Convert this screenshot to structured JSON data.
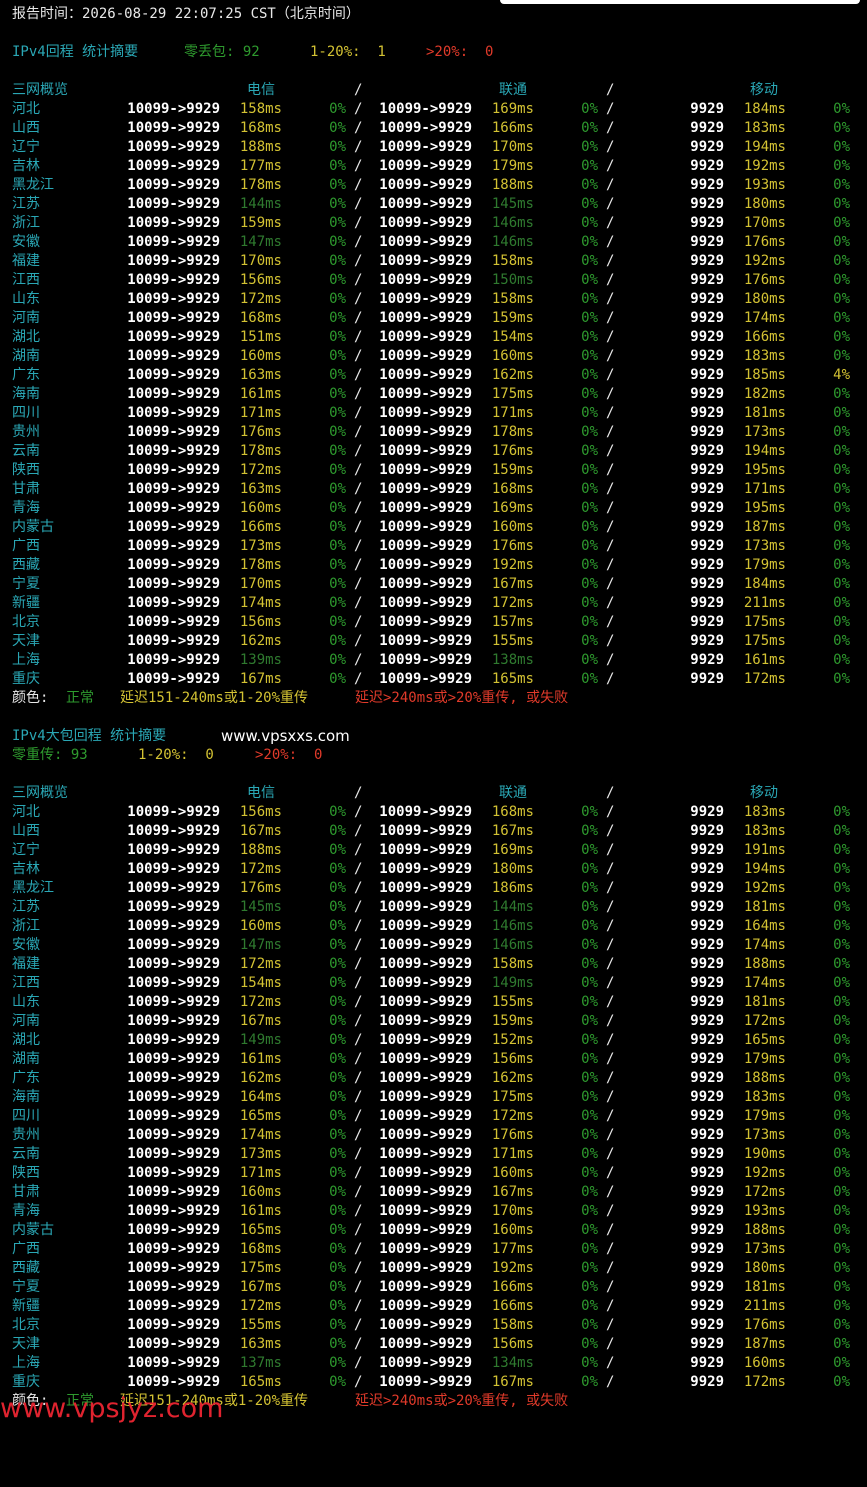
{
  "header": {
    "report_time": "报告时间：2026-08-29 22:07:25 CST（北京时间）"
  },
  "section1": {
    "title": "IPv4回程 统计摘要",
    "zero_label": "零丢包: 92",
    "mid_label": "1-20%:  1",
    "high_label": ">20%:  0",
    "head": {
      "overview": "三网概览",
      "ct": "电信",
      "cu": "联通",
      "cm": "移动",
      "slash": "/"
    },
    "rows": [
      {
        "p": "河北",
        "ct": "158ms",
        "cu": "169ms",
        "cm": "184ms",
        "cml": "0%",
        "ctc": "yl",
        "cuc": "yl",
        "cmc": "yl",
        "cmlc": "gn"
      },
      {
        "p": "山西",
        "ct": "168ms",
        "cu": "166ms",
        "cm": "183ms",
        "cml": "0%",
        "ctc": "yl",
        "cuc": "yl",
        "cmc": "yl",
        "cmlc": "gn"
      },
      {
        "p": "辽宁",
        "ct": "188ms",
        "cu": "170ms",
        "cm": "194ms",
        "cml": "0%",
        "ctc": "yl",
        "cuc": "yl",
        "cmc": "yl",
        "cmlc": "gn"
      },
      {
        "p": "吉林",
        "ct": "177ms",
        "cu": "179ms",
        "cm": "192ms",
        "cml": "0%",
        "ctc": "yl",
        "cuc": "yl",
        "cmc": "yl",
        "cmlc": "gn"
      },
      {
        "p": "黑龙江",
        "ct": "178ms",
        "cu": "188ms",
        "cm": "193ms",
        "cml": "0%",
        "ctc": "yl",
        "cuc": "yl",
        "cmc": "yl",
        "cmlc": "gn"
      },
      {
        "p": "江苏",
        "ct": "144ms",
        "cu": "145ms",
        "cm": "180ms",
        "cml": "0%",
        "ctc": "dg",
        "cuc": "dg",
        "cmc": "yl",
        "cmlc": "gn"
      },
      {
        "p": "浙江",
        "ct": "159ms",
        "cu": "146ms",
        "cm": "170ms",
        "cml": "0%",
        "ctc": "yl",
        "cuc": "dg",
        "cmc": "yl",
        "cmlc": "gn"
      },
      {
        "p": "安徽",
        "ct": "147ms",
        "cu": "146ms",
        "cm": "176ms",
        "cml": "0%",
        "ctc": "dg",
        "cuc": "dg",
        "cmc": "yl",
        "cmlc": "gn"
      },
      {
        "p": "福建",
        "ct": "170ms",
        "cu": "158ms",
        "cm": "192ms",
        "cml": "0%",
        "ctc": "yl",
        "cuc": "yl",
        "cmc": "yl",
        "cmlc": "gn"
      },
      {
        "p": "江西",
        "ct": "156ms",
        "cu": "150ms",
        "cm": "176ms",
        "cml": "0%",
        "ctc": "yl",
        "cuc": "dg",
        "cmc": "yl",
        "cmlc": "gn"
      },
      {
        "p": "山东",
        "ct": "172ms",
        "cu": "158ms",
        "cm": "180ms",
        "cml": "0%",
        "ctc": "yl",
        "cuc": "yl",
        "cmc": "yl",
        "cmlc": "gn"
      },
      {
        "p": "河南",
        "ct": "168ms",
        "cu": "159ms",
        "cm": "174ms",
        "cml": "0%",
        "ctc": "yl",
        "cuc": "yl",
        "cmc": "yl",
        "cmlc": "gn"
      },
      {
        "p": "湖北",
        "ct": "151ms",
        "cu": "154ms",
        "cm": "166ms",
        "cml": "0%",
        "ctc": "yl",
        "cuc": "yl",
        "cmc": "yl",
        "cmlc": "gn"
      },
      {
        "p": "湖南",
        "ct": "160ms",
        "cu": "160ms",
        "cm": "183ms",
        "cml": "0%",
        "ctc": "yl",
        "cuc": "yl",
        "cmc": "yl",
        "cmlc": "gn"
      },
      {
        "p": "广东",
        "ct": "163ms",
        "cu": "162ms",
        "cm": "185ms",
        "cml": "4%",
        "ctc": "yl",
        "cuc": "yl",
        "cmc": "yl",
        "cmlc": "yl"
      },
      {
        "p": "海南",
        "ct": "161ms",
        "cu": "175ms",
        "cm": "182ms",
        "cml": "0%",
        "ctc": "yl",
        "cuc": "yl",
        "cmc": "yl",
        "cmlc": "gn"
      },
      {
        "p": "四川",
        "ct": "171ms",
        "cu": "171ms",
        "cm": "181ms",
        "cml": "0%",
        "ctc": "yl",
        "cuc": "yl",
        "cmc": "yl",
        "cmlc": "gn"
      },
      {
        "p": "贵州",
        "ct": "176ms",
        "cu": "178ms",
        "cm": "173ms",
        "cml": "0%",
        "ctc": "yl",
        "cuc": "yl",
        "cmc": "yl",
        "cmlc": "gn"
      },
      {
        "p": "云南",
        "ct": "178ms",
        "cu": "176ms",
        "cm": "194ms",
        "cml": "0%",
        "ctc": "yl",
        "cuc": "yl",
        "cmc": "yl",
        "cmlc": "gn"
      },
      {
        "p": "陕西",
        "ct": "172ms",
        "cu": "159ms",
        "cm": "195ms",
        "cml": "0%",
        "ctc": "yl",
        "cuc": "yl",
        "cmc": "yl",
        "cmlc": "gn"
      },
      {
        "p": "甘肃",
        "ct": "163ms",
        "cu": "168ms",
        "cm": "171ms",
        "cml": "0%",
        "ctc": "yl",
        "cuc": "yl",
        "cmc": "yl",
        "cmlc": "gn"
      },
      {
        "p": "青海",
        "ct": "160ms",
        "cu": "169ms",
        "cm": "195ms",
        "cml": "0%",
        "ctc": "yl",
        "cuc": "yl",
        "cmc": "yl",
        "cmlc": "gn"
      },
      {
        "p": "内蒙古",
        "ct": "166ms",
        "cu": "160ms",
        "cm": "187ms",
        "cml": "0%",
        "ctc": "yl",
        "cuc": "yl",
        "cmc": "yl",
        "cmlc": "gn"
      },
      {
        "p": "广西",
        "ct": "173ms",
        "cu": "176ms",
        "cm": "173ms",
        "cml": "0%",
        "ctc": "yl",
        "cuc": "yl",
        "cmc": "yl",
        "cmlc": "gn"
      },
      {
        "p": "西藏",
        "ct": "178ms",
        "cu": "192ms",
        "cm": "179ms",
        "cml": "0%",
        "ctc": "yl",
        "cuc": "yl",
        "cmc": "yl",
        "cmlc": "gn"
      },
      {
        "p": "宁夏",
        "ct": "170ms",
        "cu": "167ms",
        "cm": "184ms",
        "cml": "0%",
        "ctc": "yl",
        "cuc": "yl",
        "cmc": "yl",
        "cmlc": "gn"
      },
      {
        "p": "新疆",
        "ct": "174ms",
        "cu": "172ms",
        "cm": "211ms",
        "cml": "0%",
        "ctc": "yl",
        "cuc": "yl",
        "cmc": "yl",
        "cmlc": "gn"
      },
      {
        "p": "北京",
        "ct": "156ms",
        "cu": "157ms",
        "cm": "175ms",
        "cml": "0%",
        "ctc": "yl",
        "cuc": "yl",
        "cmc": "yl",
        "cmlc": "gn"
      },
      {
        "p": "天津",
        "ct": "162ms",
        "cu": "155ms",
        "cm": "175ms",
        "cml": "0%",
        "ctc": "yl",
        "cuc": "yl",
        "cmc": "yl",
        "cmlc": "gn"
      },
      {
        "p": "上海",
        "ct": "139ms",
        "cu": "138ms",
        "cm": "161ms",
        "cml": "0%",
        "ctc": "dg",
        "cuc": "dg",
        "cmc": "yl",
        "cmlc": "gn"
      },
      {
        "p": "重庆",
        "ct": "167ms",
        "cu": "165ms",
        "cm": "172ms",
        "cml": "0%",
        "ctc": "yl",
        "cuc": "yl",
        "cmc": "yl",
        "cmlc": "gn"
      }
    ]
  },
  "legend": {
    "label": "颜色:",
    "normal": "正常",
    "mid": "延迟151-240ms或1-20%重传",
    "bad": "延迟>240ms或>20%重传, 或失败"
  },
  "section2": {
    "title": "IPv4大包回程 统计摘要",
    "site": "www.vpsxxs.com",
    "zero_label": "零重传: 93",
    "mid_label": "1-20%:  0",
    "high_label": ">20%:  0",
    "rows": [
      {
        "p": "河北",
        "ct": "156ms",
        "cu": "168ms",
        "cm": "183ms",
        "ctc": "yl",
        "cuc": "yl"
      },
      {
        "p": "山西",
        "ct": "167ms",
        "cu": "167ms",
        "cm": "183ms",
        "ctc": "yl",
        "cuc": "yl"
      },
      {
        "p": "辽宁",
        "ct": "188ms",
        "cu": "169ms",
        "cm": "191ms",
        "ctc": "yl",
        "cuc": "yl"
      },
      {
        "p": "吉林",
        "ct": "172ms",
        "cu": "180ms",
        "cm": "194ms",
        "ctc": "yl",
        "cuc": "yl"
      },
      {
        "p": "黑龙江",
        "ct": "176ms",
        "cu": "186ms",
        "cm": "192ms",
        "ctc": "yl",
        "cuc": "yl"
      },
      {
        "p": "江苏",
        "ct": "145ms",
        "cu": "144ms",
        "cm": "181ms",
        "ctc": "dg",
        "cuc": "dg"
      },
      {
        "p": "浙江",
        "ct": "160ms",
        "cu": "146ms",
        "cm": "164ms",
        "ctc": "yl",
        "cuc": "dg"
      },
      {
        "p": "安徽",
        "ct": "147ms",
        "cu": "146ms",
        "cm": "174ms",
        "ctc": "dg",
        "cuc": "dg"
      },
      {
        "p": "福建",
        "ct": "172ms",
        "cu": "158ms",
        "cm": "188ms",
        "ctc": "yl",
        "cuc": "yl"
      },
      {
        "p": "江西",
        "ct": "154ms",
        "cu": "149ms",
        "cm": "174ms",
        "ctc": "yl",
        "cuc": "dg"
      },
      {
        "p": "山东",
        "ct": "172ms",
        "cu": "155ms",
        "cm": "181ms",
        "ctc": "yl",
        "cuc": "yl"
      },
      {
        "p": "河南",
        "ct": "167ms",
        "cu": "159ms",
        "cm": "172ms",
        "ctc": "yl",
        "cuc": "yl"
      },
      {
        "p": "湖北",
        "ct": "149ms",
        "cu": "152ms",
        "cm": "165ms",
        "ctc": "dg",
        "cuc": "yl"
      },
      {
        "p": "湖南",
        "ct": "161ms",
        "cu": "156ms",
        "cm": "179ms",
        "ctc": "yl",
        "cuc": "yl"
      },
      {
        "p": "广东",
        "ct": "162ms",
        "cu": "162ms",
        "cm": "188ms",
        "ctc": "yl",
        "cuc": "yl"
      },
      {
        "p": "海南",
        "ct": "164ms",
        "cu": "175ms",
        "cm": "183ms",
        "ctc": "yl",
        "cuc": "yl"
      },
      {
        "p": "四川",
        "ct": "165ms",
        "cu": "172ms",
        "cm": "179ms",
        "ctc": "yl",
        "cuc": "yl"
      },
      {
        "p": "贵州",
        "ct": "174ms",
        "cu": "176ms",
        "cm": "173ms",
        "ctc": "yl",
        "cuc": "yl"
      },
      {
        "p": "云南",
        "ct": "173ms",
        "cu": "171ms",
        "cm": "190ms",
        "ctc": "yl",
        "cuc": "yl"
      },
      {
        "p": "陕西",
        "ct": "171ms",
        "cu": "160ms",
        "cm": "192ms",
        "ctc": "yl",
        "cuc": "yl"
      },
      {
        "p": "甘肃",
        "ct": "160ms",
        "cu": "167ms",
        "cm": "172ms",
        "ctc": "yl",
        "cuc": "yl"
      },
      {
        "p": "青海",
        "ct": "161ms",
        "cu": "170ms",
        "cm": "193ms",
        "ctc": "yl",
        "cuc": "yl"
      },
      {
        "p": "内蒙古",
        "ct": "165ms",
        "cu": "160ms",
        "cm": "188ms",
        "ctc": "yl",
        "cuc": "yl"
      },
      {
        "p": "广西",
        "ct": "168ms",
        "cu": "177ms",
        "cm": "173ms",
        "ctc": "yl",
        "cuc": "yl"
      },
      {
        "p": "西藏",
        "ct": "175ms",
        "cu": "192ms",
        "cm": "180ms",
        "ctc": "yl",
        "cuc": "yl"
      },
      {
        "p": "宁夏",
        "ct": "167ms",
        "cu": "166ms",
        "cm": "181ms",
        "ctc": "yl",
        "cuc": "yl"
      },
      {
        "p": "新疆",
        "ct": "172ms",
        "cu": "166ms",
        "cm": "211ms",
        "ctc": "yl",
        "cuc": "yl"
      },
      {
        "p": "北京",
        "ct": "155ms",
        "cu": "158ms",
        "cm": "176ms",
        "ctc": "yl",
        "cuc": "yl"
      },
      {
        "p": "天津",
        "ct": "163ms",
        "cu": "156ms",
        "cm": "187ms",
        "ctc": "yl",
        "cuc": "yl"
      },
      {
        "p": "上海",
        "ct": "137ms",
        "cu": "134ms",
        "cm": "160ms",
        "ctc": "dg",
        "cuc": "dg"
      },
      {
        "p": "重庆",
        "ct": "165ms",
        "cu": "167ms",
        "cm": "172ms",
        "ctc": "yl",
        "cuc": "yl"
      }
    ]
  },
  "common": {
    "route_long": "10099->9929",
    "route_short": "9929",
    "loss_zero": "0%",
    "slash": "/"
  },
  "watermark": "www.vpsjyz.com",
  "colors": {
    "background": "#000000",
    "cyan": "#2aa7b5",
    "green": "#2e9a2e",
    "yellow": "#d3c233",
    "red": "#e03a2a",
    "watermark": "#e0232f"
  }
}
